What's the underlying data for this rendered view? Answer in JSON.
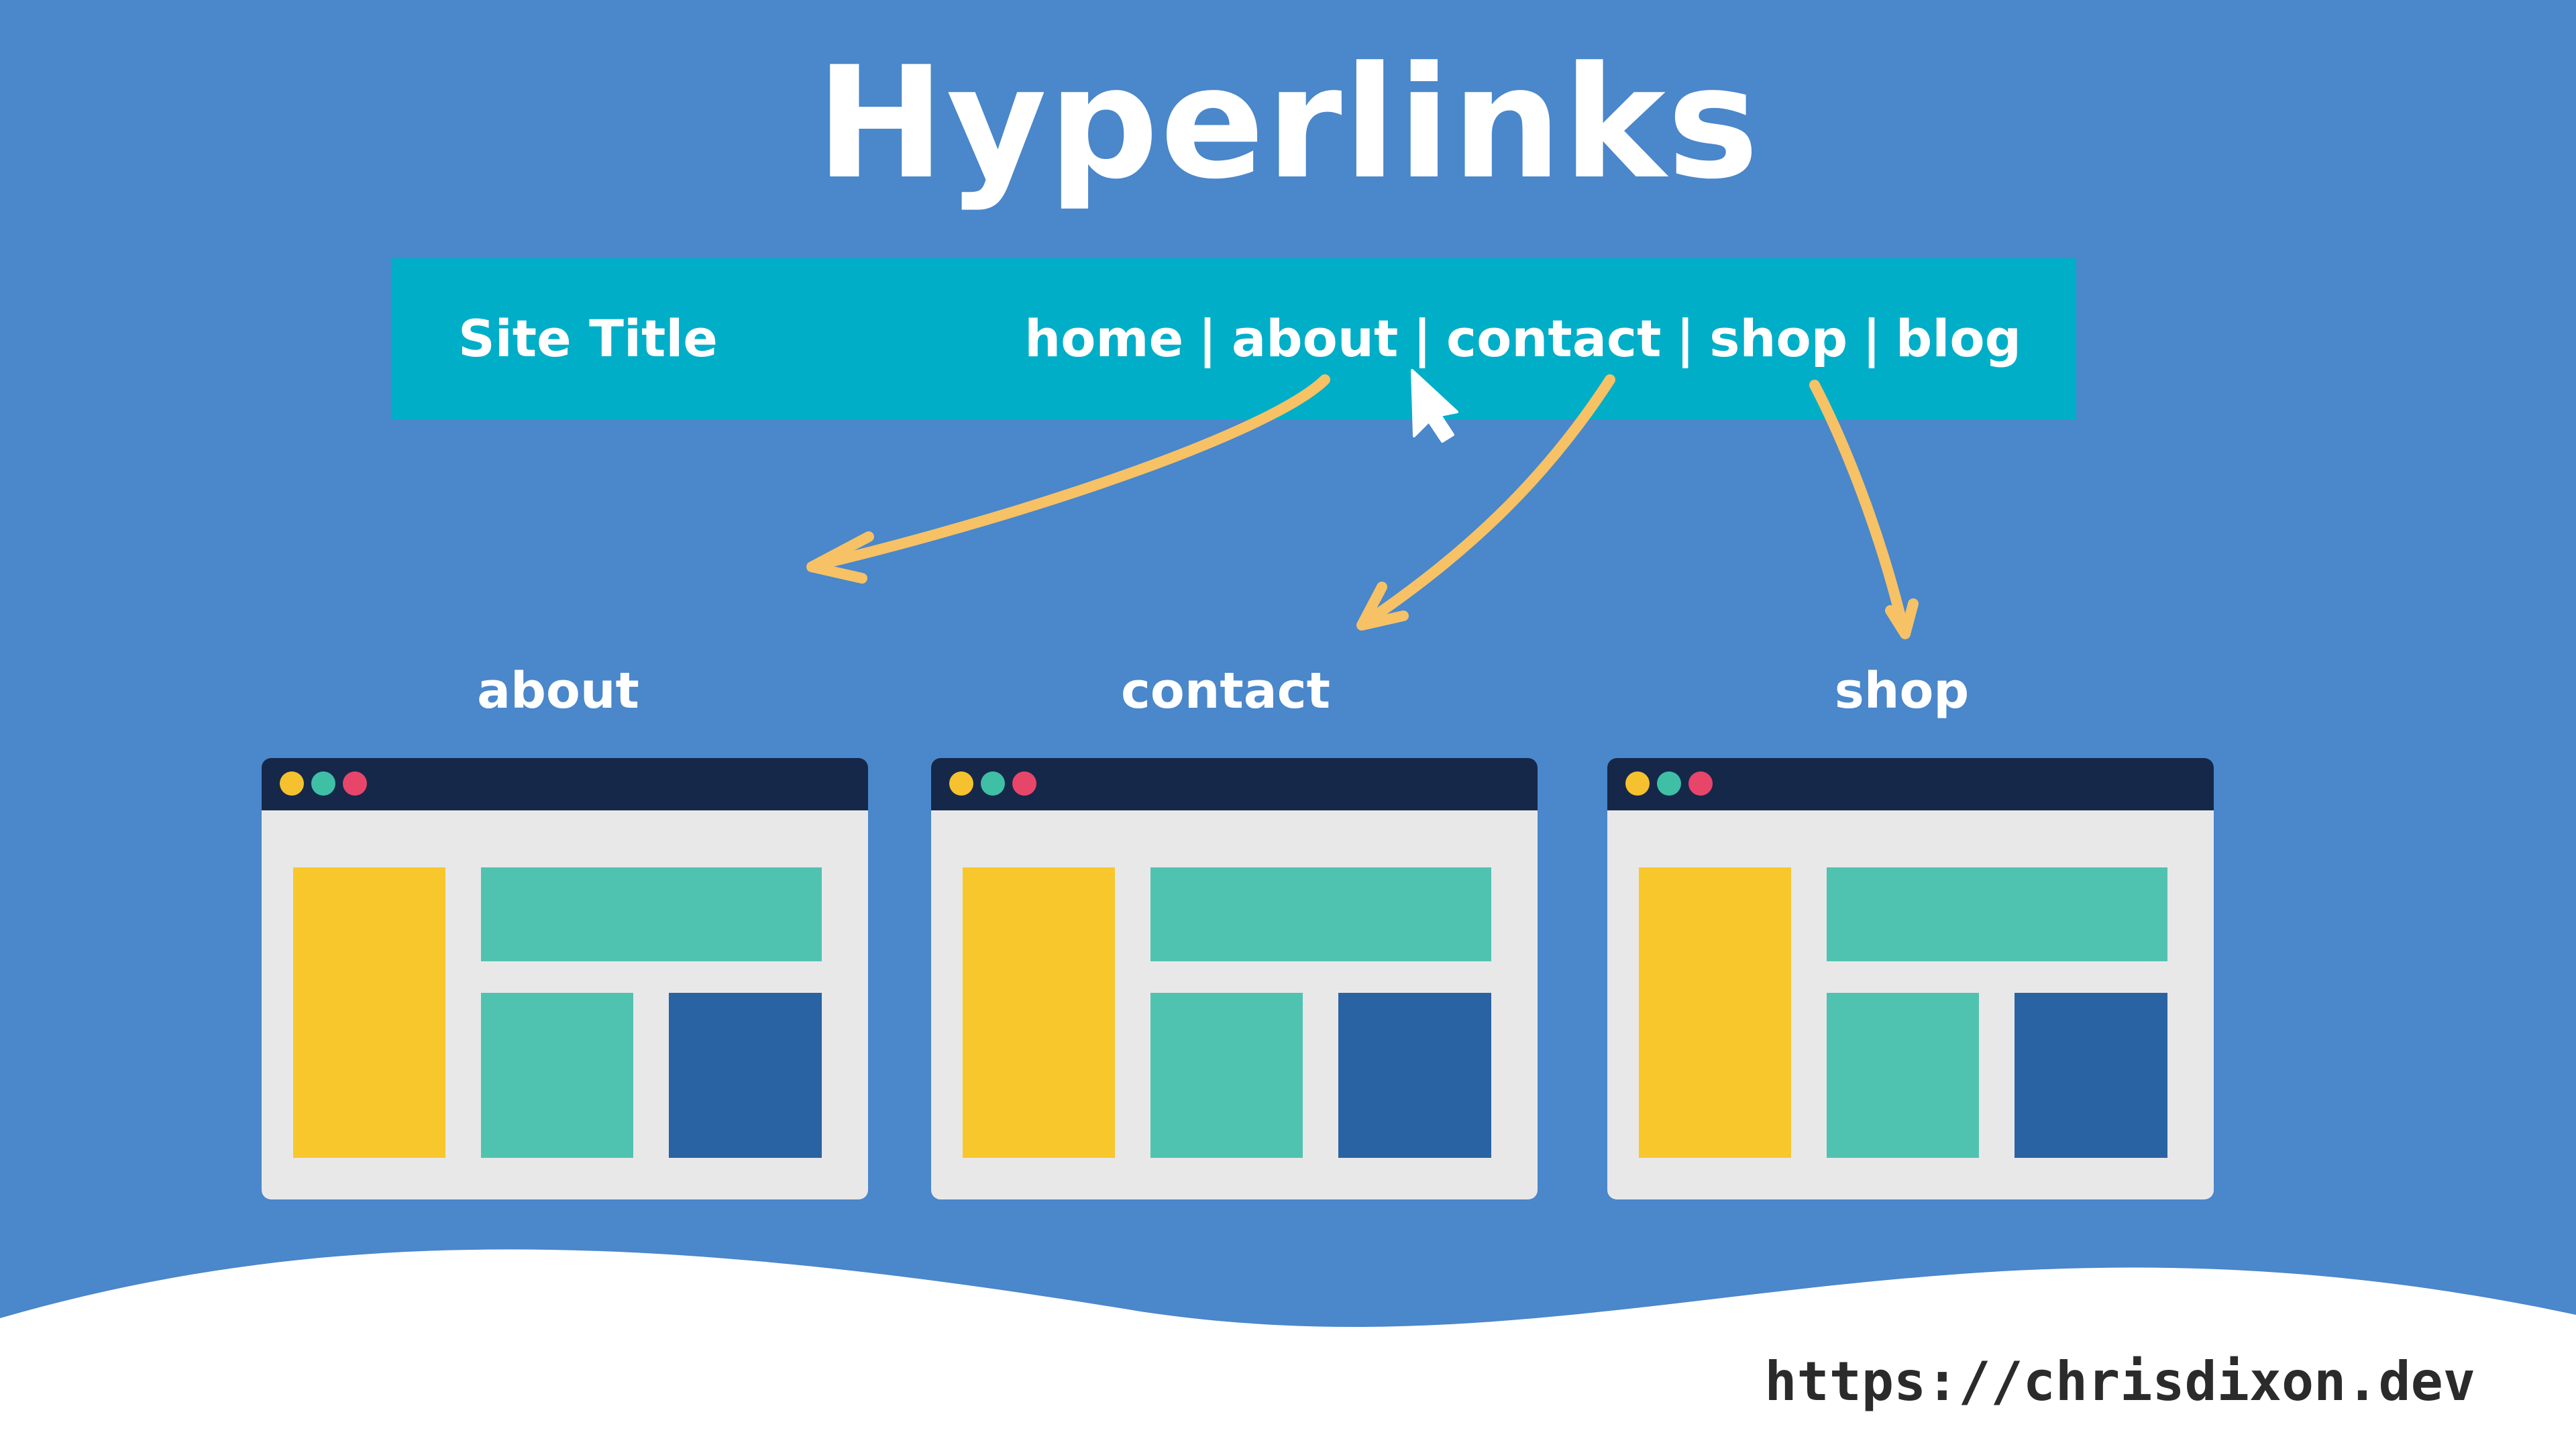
{
  "title": "Hyperlinks",
  "navbar": {
    "site_title": "Site Title",
    "links": [
      "home",
      "about",
      "contact",
      "shop",
      "blog"
    ],
    "separator": "|"
  },
  "pages": [
    {
      "label": "about"
    },
    {
      "label": "contact"
    },
    {
      "label": "shop"
    }
  ],
  "footer": {
    "url": "https://chrisdixon.dev"
  },
  "colors": {
    "background": "#4a87cb",
    "navbar": "#00aec8",
    "arrow": "#f6c265",
    "window_bar": "#15284a",
    "window_body": "#e8e8e9",
    "dot_yellow": "#f5c12e",
    "dot_teal": "#3fbfa6",
    "dot_pink": "#e8456b",
    "block_yellow": "#f8c72c",
    "block_teal": "#50c3b0",
    "block_blue": "#2a63a4",
    "wave": "#ffffff"
  }
}
